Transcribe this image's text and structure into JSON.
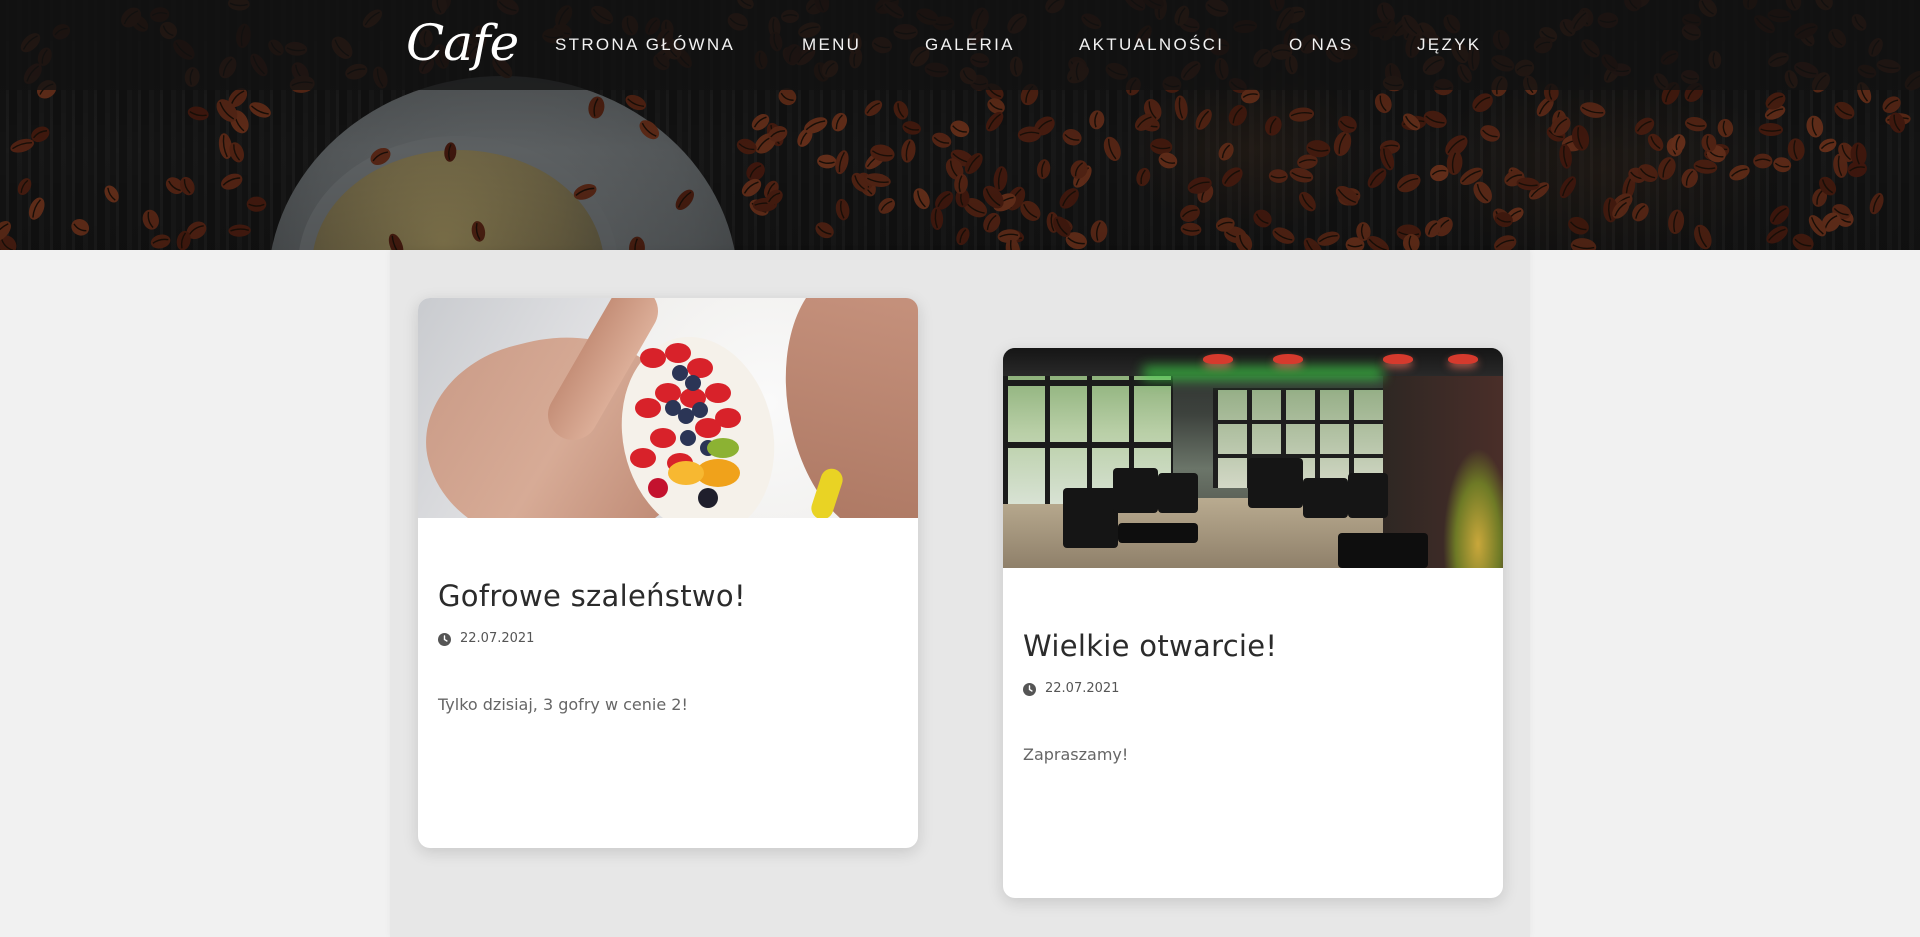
{
  "brand": {
    "logo_text": "Cafe"
  },
  "nav": {
    "items": [
      {
        "label": "STRONA GŁÓWNA",
        "id": "home"
      },
      {
        "label": "MENU",
        "id": "menu"
      },
      {
        "label": "GALERIA",
        "id": "gallery"
      },
      {
        "label": "AKTUALNOŚCI",
        "id": "news"
      },
      {
        "label": "O NAS",
        "id": "about"
      },
      {
        "label": "JĘZYK",
        "id": "language"
      }
    ]
  },
  "posts": [
    {
      "title": "Gofrowe szaleństwo!",
      "date": "22.07.2021",
      "text": "Tylko dzisiaj, 3 gofry w cenie 2!",
      "image": "fruit-waffle-photo"
    },
    {
      "title": "Wielkie otwarcie!",
      "date": "22.07.2021",
      "text": "Zapraszamy!",
      "image": "cafe-interior-photo"
    }
  ],
  "colors": {
    "nav_bg": "#121212",
    "panel_bg": "#e7e7e7",
    "page_bg": "#f1f1f1",
    "card_bg": "#ffffff",
    "title_text": "#2b2b2b"
  },
  "icons": {
    "date": "clock-icon"
  }
}
